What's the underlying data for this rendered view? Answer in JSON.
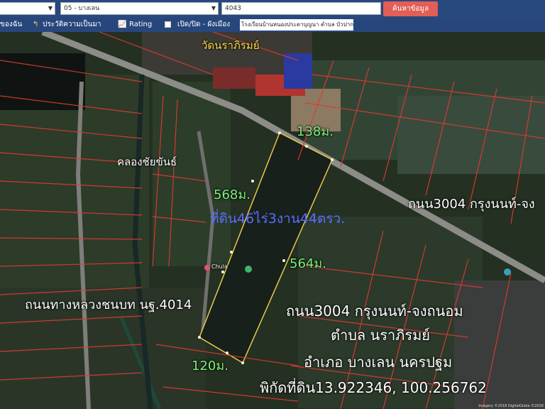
{
  "header": {
    "province_select": "",
    "district_select": "05 - บางเลน",
    "parcel_input": "4043",
    "search_button": "ค้นหาข้อมูล"
  },
  "toolbar": {
    "item1": "ของฉัน",
    "item2": "ประวัติความเป็นมา",
    "item3": "Rating",
    "item4": "เปิด/ปิด - ผังเมือง",
    "search_value": "โรงเรียนบ้านหนองประดาบุญนา ตำบล บัวปาก"
  },
  "map": {
    "temple": "วัดนราภิรมย์",
    "canal": "คลองชัยขันธ์",
    "road_3004_short": "ถนน3004 กรุงนนท์-จง",
    "side_left": "568ม.",
    "top_side": "138ม.",
    "land_area": "ที่ดิน46ไร่3งาน44ตรว.",
    "side_right": "564ม.",
    "bottom_side": "120ม.",
    "left_road": "ถนนทางหลวงชนบท นฐ.4014",
    "info_road": "ถนน3004 กรุงนนท์-จงถนอม",
    "info_tambon": "ตำบล นราภิรมย์",
    "info_amphoe": "อำเภอ บางเลน นครปฐม",
    "coords": "พิกัดที่ดิน13.922346, 100.256762",
    "poi": "Chula",
    "copyright": "Imagery ©2018 DigitalGlobe ©2018"
  }
}
